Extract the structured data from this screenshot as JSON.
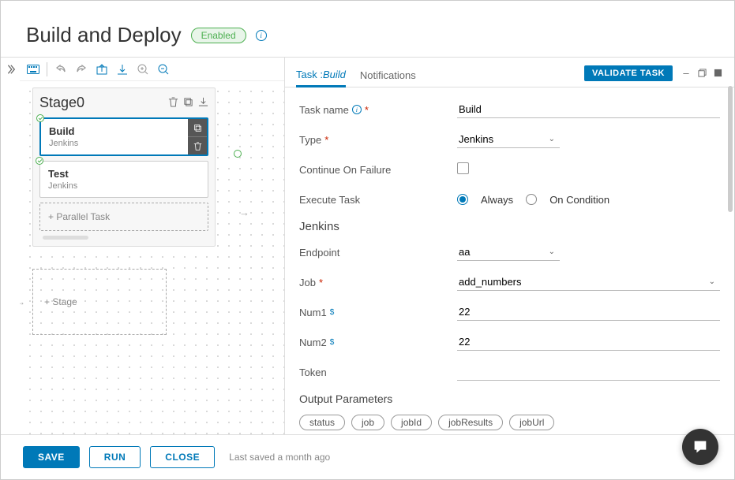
{
  "header": {
    "title": "Build and Deploy",
    "badge": "Enabled"
  },
  "canvas": {
    "stage_title": "Stage0",
    "tasks": [
      {
        "title": "Build",
        "subtitle": "Jenkins",
        "selected": true
      },
      {
        "title": "Test",
        "subtitle": "Jenkins",
        "selected": false
      }
    ],
    "parallel_label": "+ Parallel Task",
    "stage_placeholder": "+ Stage"
  },
  "detail": {
    "tabs": {
      "task_prefix": "Task :",
      "task_name": "Build",
      "notifications": "Notifications"
    },
    "validate_button": "VALIDATE TASK",
    "form": {
      "task_name_label": "Task name",
      "task_name_value": "Build",
      "type_label": "Type",
      "type_value": "Jenkins",
      "continue_label": "Continue On Failure",
      "execute_label": "Execute Task",
      "execute_always": "Always",
      "execute_condition": "On Condition",
      "jenkins_heading": "Jenkins",
      "endpoint_label": "Endpoint",
      "endpoint_value": "aa",
      "job_label": "Job",
      "job_value": "add_numbers",
      "num1_label": "Num1",
      "num1_value": "22",
      "num2_label": "Num2",
      "num2_value": "22",
      "token_label": "Token",
      "token_value": "",
      "output_heading": "Output Parameters",
      "chips": [
        "status",
        "job",
        "jobId",
        "jobResults",
        "jobUrl"
      ]
    }
  },
  "footer": {
    "save": "SAVE",
    "run": "RUN",
    "close": "CLOSE",
    "status": "Last saved a month ago"
  }
}
